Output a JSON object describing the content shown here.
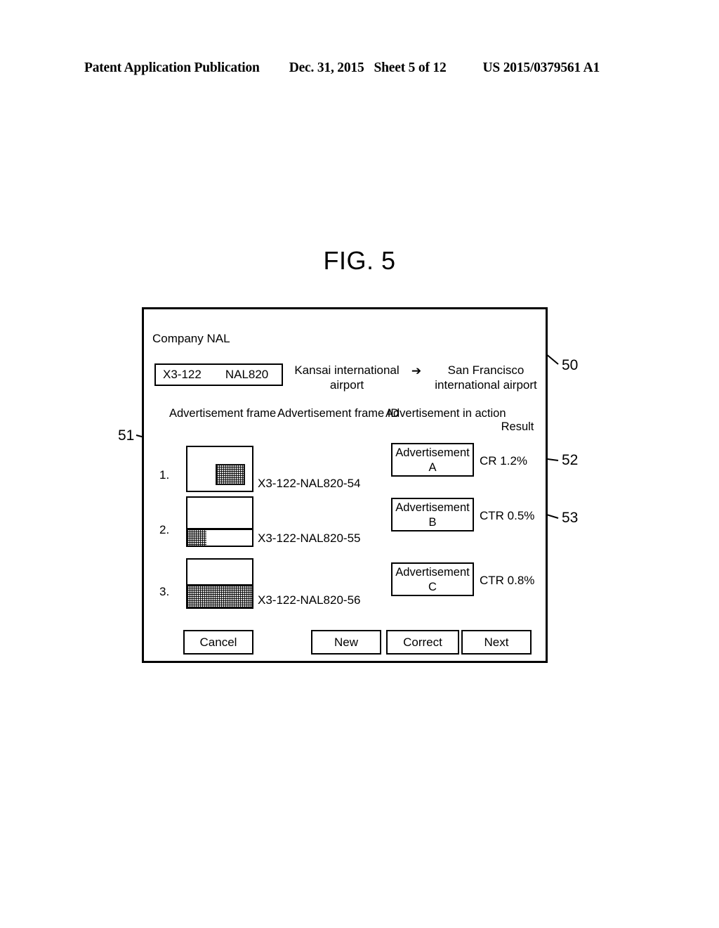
{
  "page_header": {
    "publication": "Patent Application Publication",
    "date": "Dec. 31, 2015",
    "sheet": "Sheet 5 of 12",
    "publication_number": "US 2015/0379561 A1"
  },
  "figure": {
    "title": "FIG. 5"
  },
  "dialog": {
    "company_label": "Company NAL",
    "flight": {
      "code": "X3-122",
      "number": "NAL820"
    },
    "route": {
      "origin": "Kansai international airport",
      "arrow": "➔",
      "destination": "San Francisco international airport"
    },
    "columns": {
      "advertisement_frame": "Advertisement frame",
      "advertisement_frame_id": "Advertisement frame ID",
      "advertisement_in_action": "Advertisement in action",
      "result": "Result"
    },
    "rows": [
      {
        "number": "1.",
        "frame_id": "X3-122-NAL820-54",
        "ad_name": "Advertisement",
        "ad_letter": "A",
        "result": "CR 1.2%"
      },
      {
        "number": "2.",
        "frame_id": "X3-122-NAL820-55",
        "ad_name": "Advertisement",
        "ad_letter": "B",
        "result": "CTR 0.5%"
      },
      {
        "number": "3.",
        "frame_id": "X3-122-NAL820-56",
        "ad_name": "Advertisement",
        "ad_letter": "C",
        "result": "CTR 0.8%"
      }
    ],
    "buttons": {
      "cancel": "Cancel",
      "new": "New",
      "correct": "Correct",
      "next": "Next"
    }
  },
  "reference_numerals": {
    "panel": "50",
    "advertisement_frame": "51",
    "advertisement_in_action": "52",
    "result": "53"
  },
  "colors": {
    "line": "#000000",
    "background": "#ffffff",
    "shading": "#d8d8d8"
  }
}
